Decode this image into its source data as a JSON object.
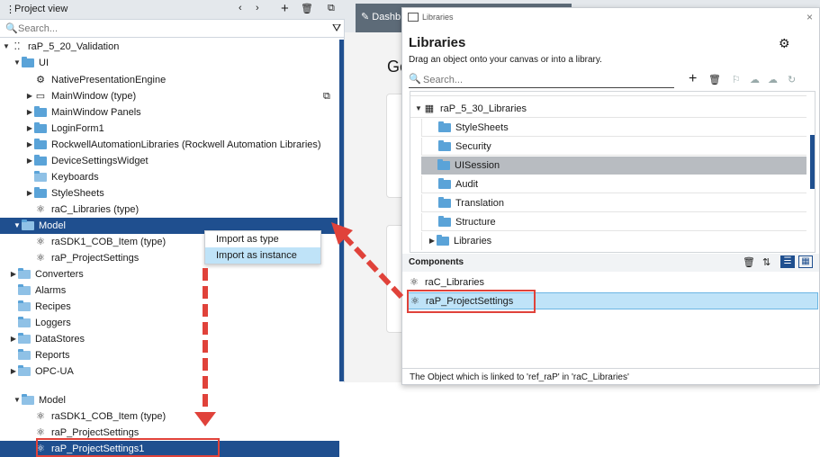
{
  "colors": {
    "accent": "#1f4f8f",
    "selected_light": "#bfe3f8",
    "highlight_red": "#e0423a",
    "folder": "#5aa3d8"
  },
  "project_view": {
    "title": "Project view",
    "search_placeholder": "Search...",
    "tree": [
      {
        "label": "raP_5_20_Validation",
        "icon": "project-icon"
      },
      {
        "label": "UI",
        "icon": "folder-icon"
      },
      {
        "label": "NativePresentationEngine",
        "icon": "gear-icon"
      },
      {
        "label": "MainWindow (type)",
        "icon": "window-icon"
      },
      {
        "label": "MainWindow Panels",
        "icon": "folder-icon"
      },
      {
        "label": "LoginForm1",
        "icon": "folder-icon"
      },
      {
        "label": "RockwellAutomationLibraries (Rockwell Automation Libraries)",
        "icon": "folder-icon"
      },
      {
        "label": "DeviceSettingsWidget",
        "icon": "folder-icon"
      },
      {
        "label": "Keyboards",
        "icon": "folder-icon"
      },
      {
        "label": "StyleSheets",
        "icon": "folder-icon"
      },
      {
        "label": "raC_Libraries (type)",
        "icon": "object-icon"
      },
      {
        "label": "Model",
        "icon": "model-folder-icon"
      },
      {
        "label": "raSDK1_COB_Item (type)",
        "icon": "object-icon"
      },
      {
        "label": "raP_ProjectSettings",
        "icon": "object-icon"
      },
      {
        "label": "Converters",
        "icon": "folder-icon"
      },
      {
        "label": "Alarms",
        "icon": "folder-icon"
      },
      {
        "label": "Recipes",
        "icon": "folder-icon"
      },
      {
        "label": "Loggers",
        "icon": "folder-icon"
      },
      {
        "label": "DataStores",
        "icon": "folder-icon"
      },
      {
        "label": "Reports",
        "icon": "folder-icon"
      },
      {
        "label": "OPC-UA",
        "icon": "folder-icon"
      }
    ]
  },
  "context_menu": {
    "items": [
      "Import as type",
      "Import as instance"
    ]
  },
  "result_tree": [
    {
      "label": "Model",
      "icon": "model-folder-icon"
    },
    {
      "label": "raSDK1_COB_Item (type)",
      "icon": "object-icon"
    },
    {
      "label": "raP_ProjectSettings",
      "icon": "object-icon"
    },
    {
      "label": "raP_ProjectSettings1",
      "icon": "object-icon"
    }
  ],
  "dashboard": {
    "tab_label": "Dashb",
    "heading_partial": "Ge"
  },
  "libraries": {
    "window_title": "Libraries",
    "heading": "Libraries",
    "hint": "Drag an object onto your canvas or into a library.",
    "search_placeholder": "Search...",
    "tree": [
      {
        "label": "raP_5_30_Libraries"
      },
      {
        "label": "StyleSheets"
      },
      {
        "label": "Security"
      },
      {
        "label": "UISession"
      },
      {
        "label": "Audit"
      },
      {
        "label": "Translation"
      },
      {
        "label": "Structure"
      },
      {
        "label": "Libraries"
      }
    ],
    "components_title": "Components",
    "components": [
      "raC_Libraries",
      "raP_ProjectSettings"
    ],
    "footer": "The Object which is linked to 'ref_raP' in 'raC_Libraries'"
  }
}
